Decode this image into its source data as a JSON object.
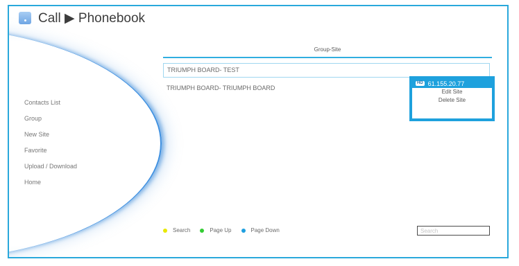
{
  "title": {
    "icon": "phone-icon",
    "text": "Call ▶ Phonebook"
  },
  "menu": {
    "items": [
      {
        "label": "Contacts List"
      },
      {
        "label": "Group"
      },
      {
        "label": "New Site"
      },
      {
        "label": "Favorite"
      },
      {
        "label": "Upload / Download"
      },
      {
        "label": "Home"
      }
    ]
  },
  "group": {
    "header": "Group-Site",
    "rows": [
      {
        "label": "TRIUMPH BOARD- TEST",
        "selected": true
      },
      {
        "label": "TRIUMPH BOARD- TRIUMPH BOARD",
        "selected": false
      }
    ]
  },
  "context_menu": {
    "badge": "HD",
    "ip": "61.155.20.77",
    "edit": "Edit Site",
    "delete": "Delete Site"
  },
  "footer": {
    "legend": [
      {
        "label": "Search",
        "color": "#e8e800"
      },
      {
        "label": "Page Up",
        "color": "#33cc33"
      },
      {
        "label": "Page Down",
        "color": "#1e9fe0"
      }
    ],
    "search_placeholder": "Search"
  },
  "colors": {
    "accent": "#1ea1dd",
    "frame": "#29a8db"
  }
}
